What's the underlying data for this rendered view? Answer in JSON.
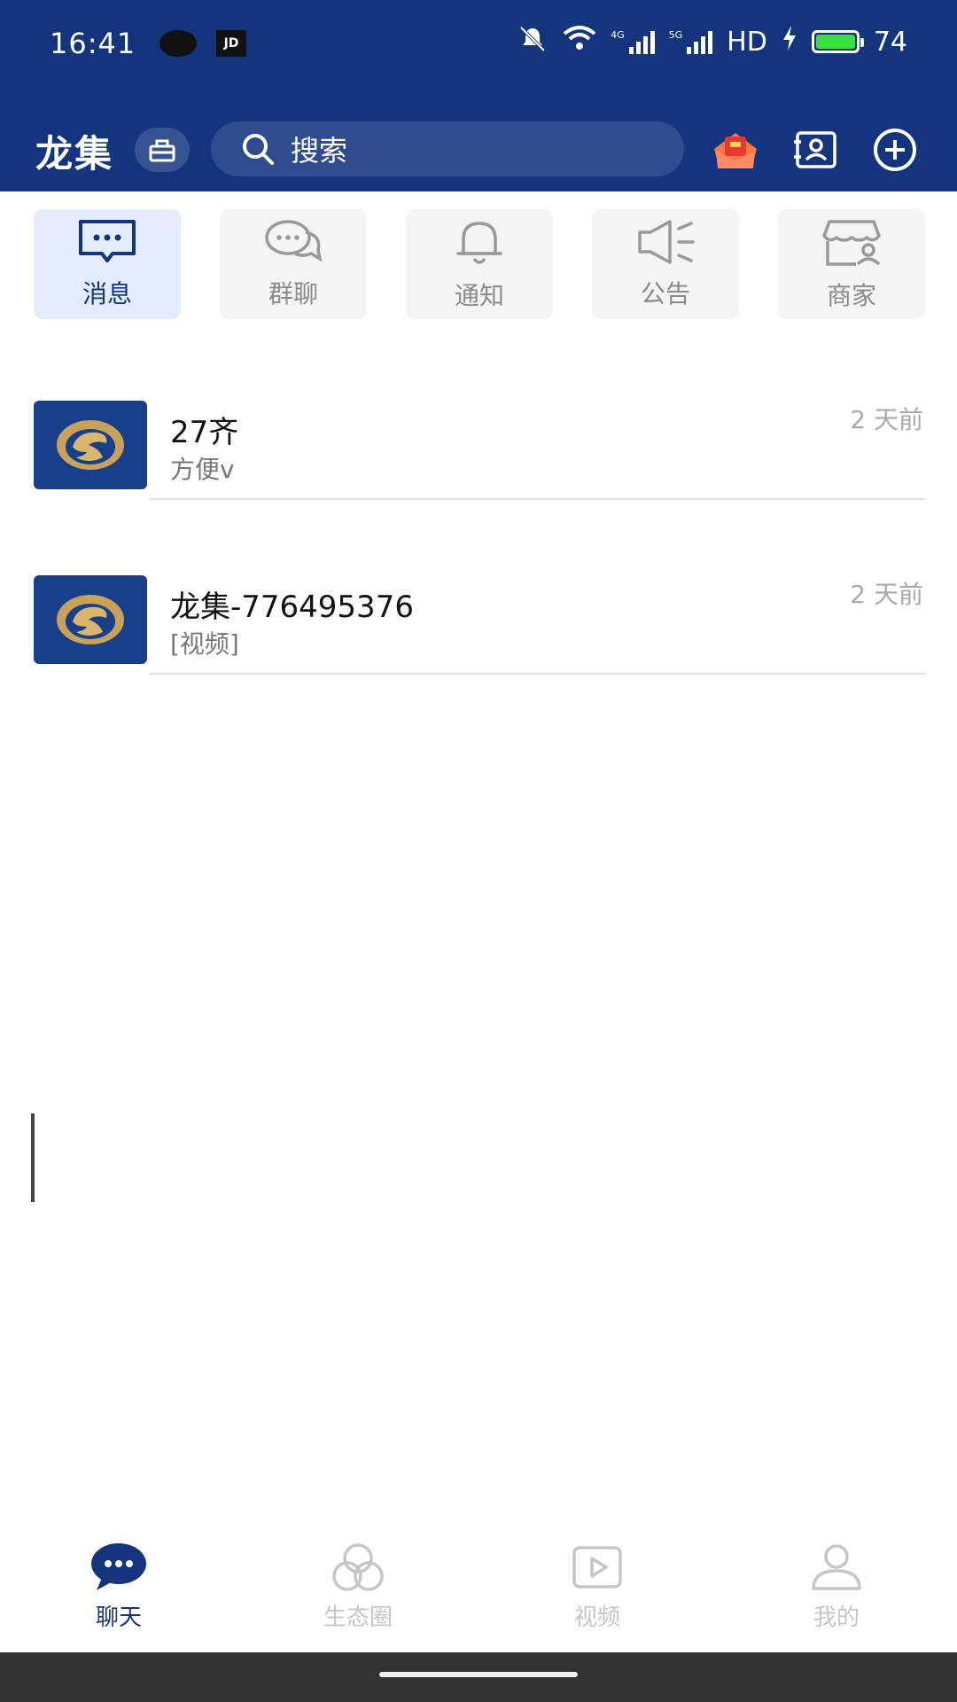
{
  "status_bar": {
    "time": "16:41",
    "jd_label": "JD",
    "net_4g": "4G",
    "net_5g": "5G",
    "hd_label": "HD",
    "battery_level": "74"
  },
  "header": {
    "title": "龙集",
    "search_placeholder": "搜索"
  },
  "categories": [
    {
      "label": "消息",
      "icon": "message-dots-icon",
      "active": true
    },
    {
      "label": "群聊",
      "icon": "group-chat-icon",
      "active": false
    },
    {
      "label": "通知",
      "icon": "bell-icon",
      "active": false
    },
    {
      "label": "公告",
      "icon": "megaphone-icon",
      "active": false
    },
    {
      "label": "商家",
      "icon": "store-icon",
      "active": false
    }
  ],
  "conversations": [
    {
      "name": "27齐",
      "preview": "方便v",
      "time": "2 天前"
    },
    {
      "name": "龙集-776495376",
      "preview": "[视频]",
      "time": "2 天前"
    }
  ],
  "tabs": [
    {
      "label": "聊天",
      "icon": "chat-bubble-icon",
      "active": true
    },
    {
      "label": "生态圈",
      "icon": "circles-icon",
      "active": false
    },
    {
      "label": "视频",
      "icon": "video-play-icon",
      "active": false
    },
    {
      "label": "我的",
      "icon": "person-icon",
      "active": false
    }
  ],
  "colors": {
    "brand": "#14347e",
    "active_category_bg": "#e4ebfa",
    "inactive_text": "#c6c6c6"
  }
}
